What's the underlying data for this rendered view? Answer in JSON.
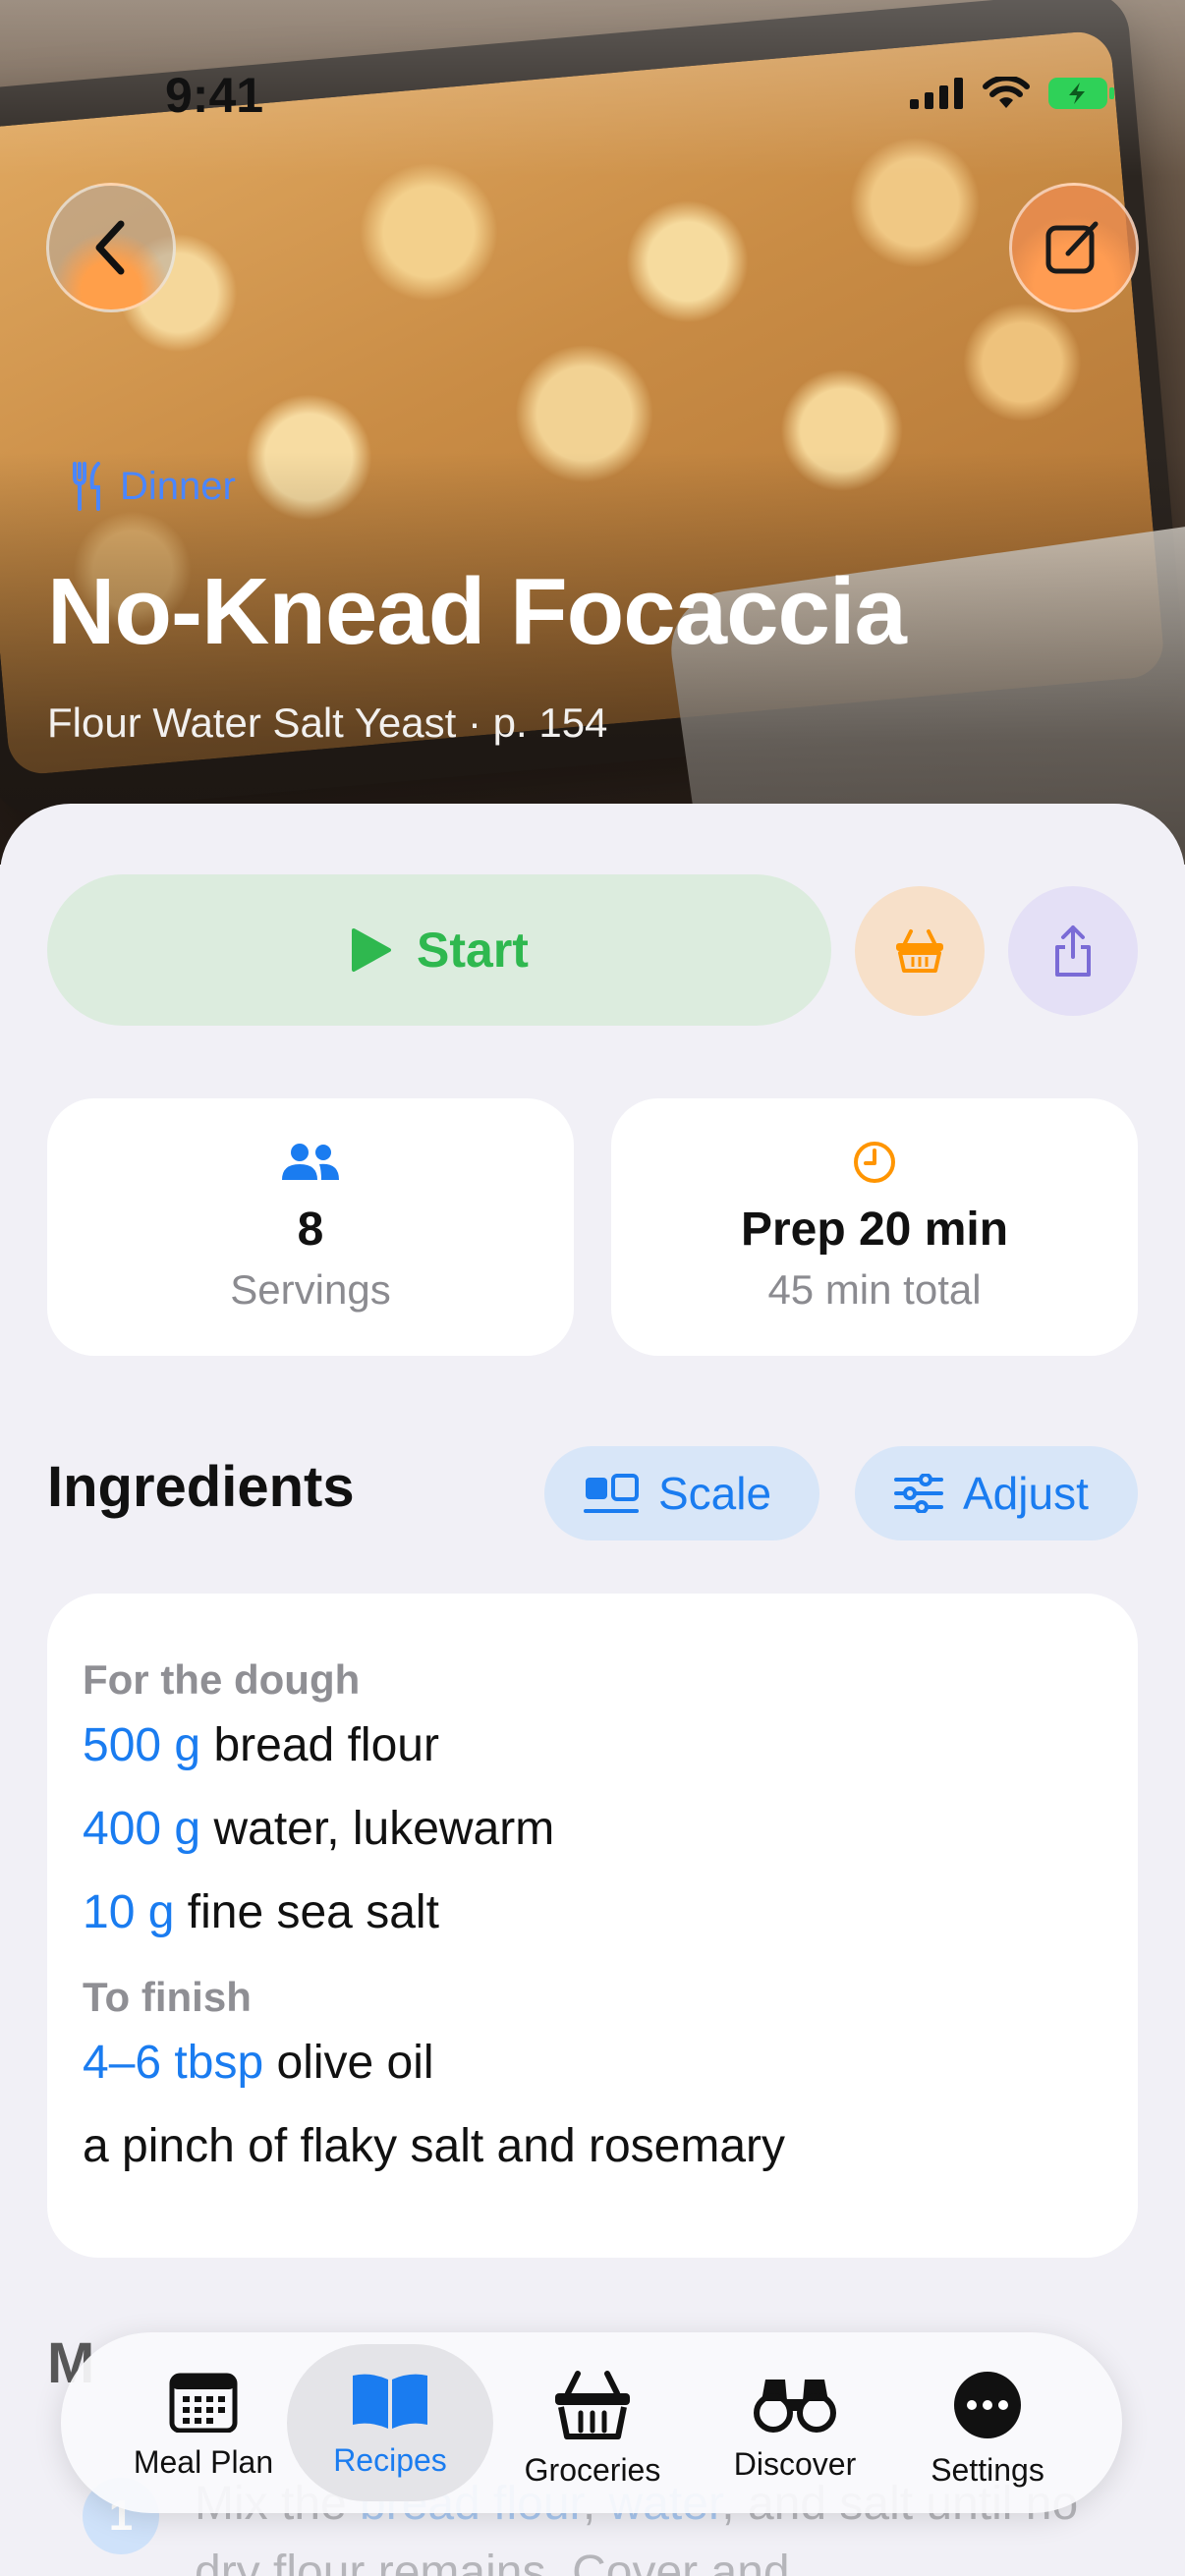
{
  "status": {
    "time": "9:41"
  },
  "hero": {
    "category": "Dinner",
    "title": "No-Knead Focaccia",
    "subtitle": "Flour Water Salt Yeast · p. 154"
  },
  "actions": {
    "start_label": "Start"
  },
  "stats": {
    "servings_value": "8",
    "servings_label": "Servings",
    "prep_value": "Prep 20 min",
    "total_label": "45 min total"
  },
  "ingredients": {
    "title": "Ingredients",
    "scale_label": "Scale",
    "adjust_label": "Adjust",
    "groups": [
      {
        "heading": "For the dough",
        "items": [
          {
            "qty": "500 g",
            "text": " bread flour"
          },
          {
            "qty": "400 g",
            "text": " water, lukewarm"
          },
          {
            "qty": "10 g",
            "text": " fine sea salt"
          }
        ]
      },
      {
        "heading": "To finish",
        "items": [
          {
            "qty": "4–6 tbsp",
            "text": " olive oil"
          },
          {
            "qty": "",
            "text": "a pinch of flaky salt and rosemary"
          }
        ]
      }
    ]
  },
  "method": {
    "title": "M",
    "step_number": "1",
    "step_text_a": "Mix the ",
    "step_text_hl1": "bread flour",
    "step_text_b": ", ",
    "step_text_hl2": "water",
    "step_text_c": ", and salt until no dry flour remains. Cover and"
  },
  "tabbar": {
    "tabs": [
      {
        "label": "Meal Plan",
        "icon": "calendar-icon"
      },
      {
        "label": "Recipes",
        "icon": "book-icon",
        "active": true
      },
      {
        "label": "Groceries",
        "icon": "basket-icon"
      },
      {
        "label": "Discover",
        "icon": "binoculars-icon"
      },
      {
        "label": "Settings",
        "icon": "ellipsis-icon"
      }
    ]
  },
  "colors": {
    "accent": "#1a7cf0",
    "start_green": "#2fb84f",
    "orange": "#ff9500",
    "purple": "#7a6bd6"
  }
}
